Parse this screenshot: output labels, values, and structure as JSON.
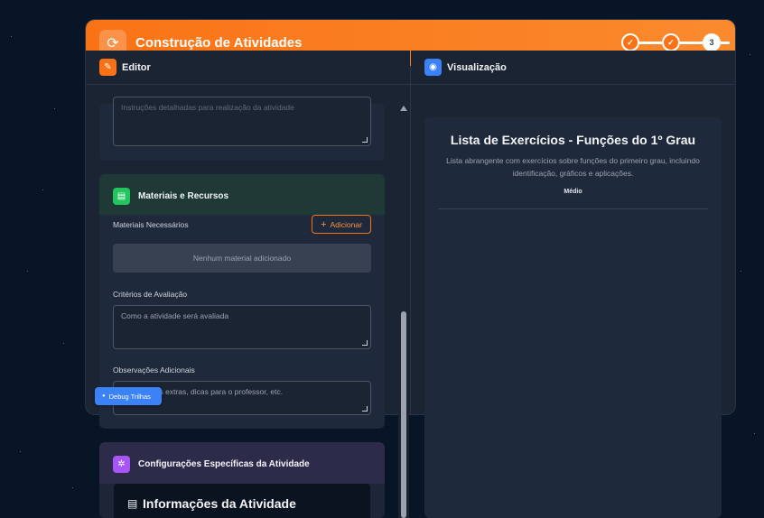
{
  "modal": {
    "title": "Construção de Atividades",
    "stepper": {
      "steps": [
        "✓",
        "✓",
        "3"
      ],
      "current_step": 3
    }
  },
  "editor": {
    "header": "Editor",
    "top_textarea_placeholder": "Instruções detalhadas para realização da atividade",
    "materials": {
      "title": "Materiais e Recursos",
      "needed_label": "Materiais Necessários",
      "add_button": "Adicionar",
      "empty_text": "Nenhum material adicionado"
    },
    "criteria": {
      "label": "Critérios de Avaliação",
      "placeholder": "Como a atividade será avaliada"
    },
    "observations": {
      "label": "Observações Adicionais",
      "placeholder": "Informações extras, dicas para o professor, etc."
    },
    "config": {
      "title": "Configurações Específicas da Atividade",
      "info_title": "Informações da Atividade"
    },
    "debug_button": "Debug Trilhas"
  },
  "preview": {
    "header": "Visualização",
    "title": "Lista de Exercícios - Funções do 1º Grau",
    "description": "Lista abrangente com exercícios sobre funções do primeiro grau, incluindo identificação, gráficos e aplicações.",
    "difficulty": "Médio"
  },
  "icons": {
    "header": "refresh-icon",
    "editor": "edit-icon",
    "preview": "eye-icon",
    "materials": "book-icon",
    "config": "gear-icon",
    "info": "document-icon"
  },
  "colors": {
    "accent": "#f97316",
    "blue": "#3b82f6",
    "green": "#22c55e",
    "purple": "#a855f7",
    "background": "#071526"
  }
}
